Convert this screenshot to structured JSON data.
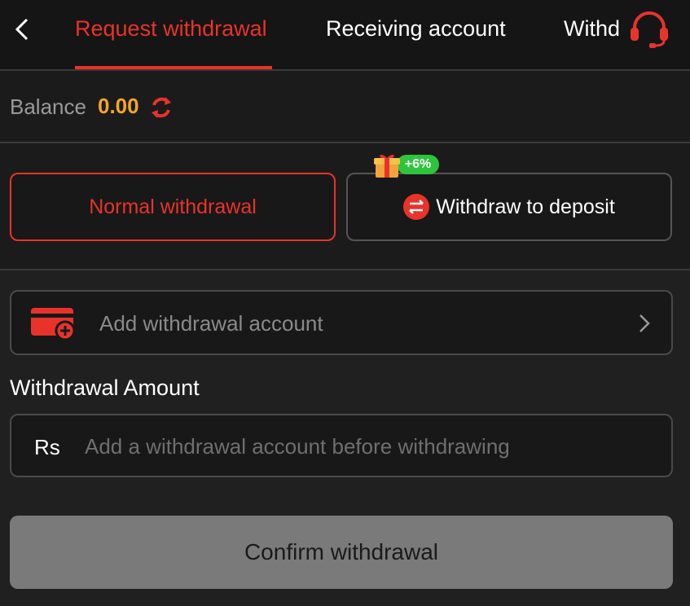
{
  "header": {
    "tabs": [
      {
        "label": "Request withdrawal",
        "active": true
      },
      {
        "label": "Receiving account",
        "active": false
      },
      {
        "label": "Withdrawal record",
        "active": false
      }
    ],
    "back_icon": "chevron-left-icon",
    "support_icon": "headset-icon"
  },
  "balance": {
    "label": "Balance",
    "value": "0.00",
    "refresh_icon": "refresh-icon"
  },
  "methods": {
    "normal_label": "Normal withdrawal",
    "deposit_label": "Withdraw to deposit",
    "promo_badge": "+6%",
    "promo_icon": "gift-icon"
  },
  "account": {
    "add_label": "Add withdrawal account",
    "card_icon": "card-add-icon",
    "chevron_icon": "chevron-right-icon"
  },
  "amount": {
    "title": "Withdrawal Amount",
    "currency": "Rs",
    "placeholder": "Add a withdrawal account before withdrawing",
    "value": ""
  },
  "confirm_label": "Confirm withdrawal",
  "colors": {
    "accent": "#e8332b",
    "balance": "#f5a623",
    "promo": "#2ec43d"
  }
}
